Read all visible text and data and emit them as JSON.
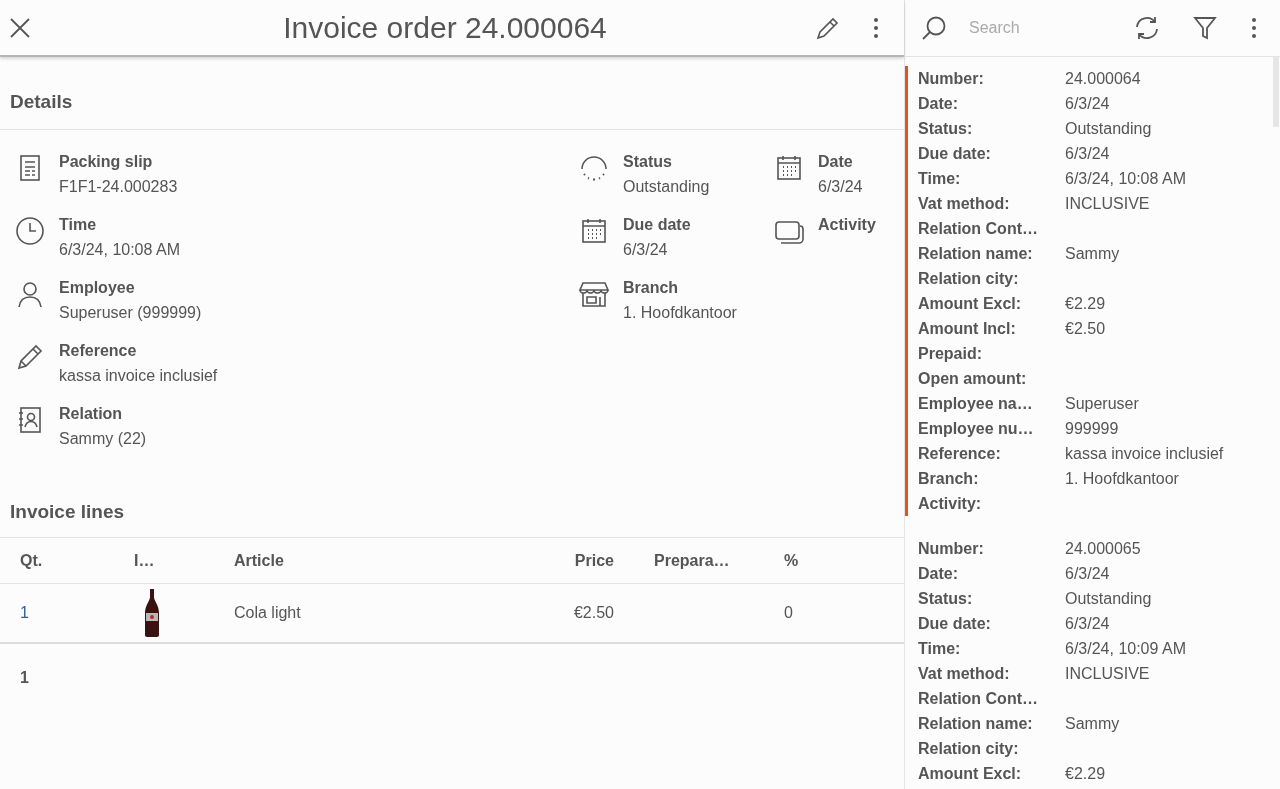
{
  "header": {
    "title": "Invoice order 24.000064"
  },
  "details": {
    "heading": "Details",
    "columns": [
      [
        {
          "label": "Packing slip",
          "value": "F1F1-24.000283"
        },
        {
          "label": "Time",
          "value": "6/3/24, 10:08 AM"
        },
        {
          "label": "Employee",
          "value": "Superuser (999999)"
        },
        {
          "label": "Reference",
          "value": "kassa invoice inclusief"
        },
        {
          "label": "Relation",
          "value": "Sammy (22)"
        }
      ],
      [
        {
          "label": "Status",
          "value": "Outstanding"
        },
        {
          "label": "Due date",
          "value": "6/3/24"
        },
        {
          "label": "Branch",
          "value": "1. Hoofdkantoor"
        }
      ],
      [
        {
          "label": "Date",
          "value": "6/3/24"
        },
        {
          "label": "Activity"
        }
      ]
    ]
  },
  "invoice_lines": {
    "heading": "Invoice lines",
    "columns": [
      "Qt.",
      "I…",
      "Article",
      "Price",
      "Prepara…",
      "%"
    ],
    "rows": [
      {
        "cells": [
          {
            "kind": "link",
            "text": "1"
          },
          {
            "kind": "image"
          },
          {
            "kind": "text",
            "text": "Cola light"
          },
          {
            "kind": "text",
            "text": "€2.50"
          },
          {
            "kind": "text"
          },
          {
            "kind": "text",
            "text": "0"
          }
        ]
      }
    ],
    "footer": "1"
  },
  "sidebar": {
    "search": {
      "placeholder": "Search"
    },
    "records": [
      {
        "selected": true,
        "fields": [
          {
            "label": "Number:",
            "value": "24.000064"
          },
          {
            "label": "Date:",
            "value": "6/3/24"
          },
          {
            "label": "Status:",
            "value": "Outstanding"
          },
          {
            "label": "Due date:",
            "value": "6/3/24"
          },
          {
            "label": "Time:",
            "value": "6/3/24, 10:08 AM"
          },
          {
            "label": "Vat method:",
            "value": "INCLUSIVE"
          },
          {
            "label": "Relation Cont…"
          },
          {
            "label": "Relation name:",
            "value": "Sammy"
          },
          {
            "label": "Relation city:"
          },
          {
            "label": "Amount Excl:",
            "value": "€2.29"
          },
          {
            "label": "Amount Incl:",
            "value": "€2.50"
          },
          {
            "label": "Prepaid:"
          },
          {
            "label": "Open amount:"
          },
          {
            "label": "Employee na…",
            "value": "Superuser"
          },
          {
            "label": "Employee nu…",
            "value": "999999"
          },
          {
            "label": "Reference:",
            "value": "kassa invoice inclusief"
          },
          {
            "label": "Branch:",
            "value": "1. Hoofdkantoor"
          },
          {
            "label": "Activity:"
          }
        ]
      },
      {
        "selected": false,
        "fields": [
          {
            "label": "Number:",
            "value": "24.000065"
          },
          {
            "label": "Date:",
            "value": "6/3/24"
          },
          {
            "label": "Status:",
            "value": "Outstanding"
          },
          {
            "label": "Due date:",
            "value": "6/3/24"
          },
          {
            "label": "Time:",
            "value": "6/3/24, 10:09 AM"
          },
          {
            "label": "Vat method:",
            "value": "INCLUSIVE"
          },
          {
            "label": "Relation Cont…"
          },
          {
            "label": "Relation name:",
            "value": "Sammy"
          },
          {
            "label": "Relation city:"
          },
          {
            "label": "Amount Excl:",
            "value": "€2.29"
          }
        ]
      }
    ]
  }
}
